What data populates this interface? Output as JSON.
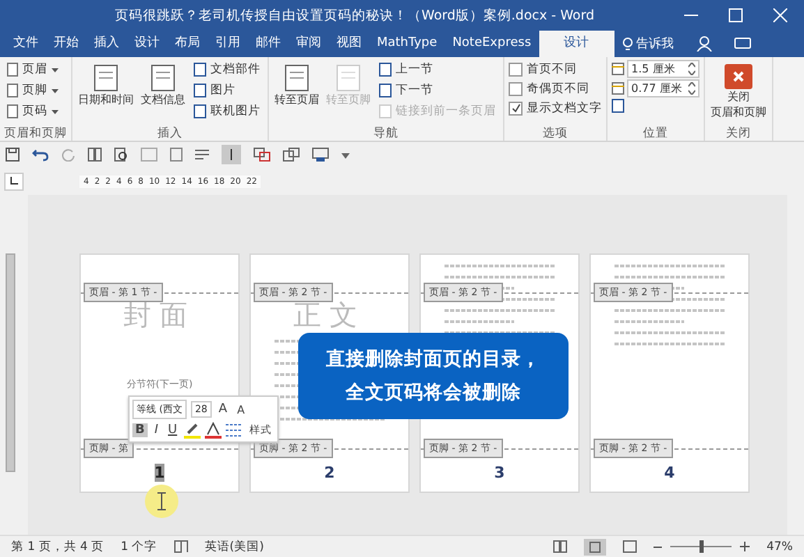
{
  "window": {
    "title": "页码很跳跃？老司机传授自由设置页码的秘诀！（Word版）案例.docx - Word"
  },
  "tabs": [
    {
      "label": "文件",
      "selected": false
    },
    {
      "label": "开始",
      "selected": false
    },
    {
      "label": "插入",
      "selected": false
    },
    {
      "label": "设计",
      "selected": false
    },
    {
      "label": "布局",
      "selected": false
    },
    {
      "label": "引用",
      "selected": false
    },
    {
      "label": "邮件",
      "selected": false
    },
    {
      "label": "审阅",
      "selected": false
    },
    {
      "label": "视图",
      "selected": false
    },
    {
      "label": "MathType",
      "selected": false
    },
    {
      "label": "NoteExpress",
      "selected": false
    },
    {
      "label": "设计",
      "selected": true
    }
  ],
  "tell_me": "告诉我",
  "ribbon": {
    "groups": [
      {
        "label": "页眉和页脚",
        "kind": "dropdowns",
        "items": [
          {
            "label": "页眉",
            "disabled": false
          },
          {
            "label": "页脚",
            "disabled": false
          },
          {
            "label": "页码",
            "disabled": false
          }
        ]
      },
      {
        "label": "插入",
        "kind": "mixed",
        "large": [
          {
            "label": "日期和时间",
            "disabled": false
          },
          {
            "label": "文档信息",
            "disabled": false
          }
        ],
        "items": [
          {
            "label": "文档部件",
            "disabled": false
          },
          {
            "label": "图片",
            "disabled": false
          },
          {
            "label": "联机图片",
            "disabled": false
          }
        ]
      },
      {
        "label": "导航",
        "kind": "mixed",
        "large": [
          {
            "label": "转至页眉",
            "disabled": false
          },
          {
            "label": "转至页脚",
            "disabled": true
          }
        ],
        "items": [
          {
            "label": "上一节",
            "disabled": false
          },
          {
            "label": "下一节",
            "disabled": false
          },
          {
            "label": "链接到前一条页眉",
            "disabled": true
          }
        ]
      },
      {
        "label": "选项",
        "kind": "checks",
        "items": [
          {
            "label": "首页不同",
            "checked": false
          },
          {
            "label": "奇偶页不同",
            "checked": false
          },
          {
            "label": "显示文档文字",
            "checked": true
          }
        ]
      },
      {
        "label": "位置",
        "kind": "spins",
        "items": [
          {
            "value": "1.5 厘米"
          },
          {
            "value": "0.77 厘米"
          }
        ]
      },
      {
        "label": "关闭",
        "kind": "close",
        "items": [
          {
            "lines": [
              "关闭",
              "页眉和页脚"
            ]
          }
        ]
      }
    ]
  },
  "ruler": {
    "ticks": [
      "4",
      "2",
      "2",
      "4",
      "6",
      "8",
      "10",
      "12",
      "14",
      "16",
      "18",
      "20",
      "22"
    ]
  },
  "pages": [
    {
      "kind": "cover",
      "title": "封面",
      "header_tag": "页眉 - 第 1 节 -",
      "footer_tag": "页脚 - 第",
      "section_break": "分节符(下一页)",
      "number": "1",
      "number_selected": true
    },
    {
      "kind": "body",
      "title": "正文",
      "header_tag": "页眉 - 第 2 节 -",
      "footer_tag": "页脚 - 第 2 节 -",
      "number": "2",
      "number_selected": false
    },
    {
      "kind": "body",
      "header_tag": "页眉 - 第 2 节 -",
      "footer_tag": "页脚 - 第 2 节 -",
      "number": "3",
      "number_selected": false
    },
    {
      "kind": "body",
      "header_tag": "页眉 - 第 2 节 -",
      "footer_tag": "页脚 - 第 2 节 -",
      "number": "4",
      "number_selected": false
    }
  ],
  "mini_toolbar": {
    "font": "等线 (西文",
    "size": "28",
    "grow": "A",
    "shrink": "A",
    "style_label": "样式",
    "buttons": [
      {
        "label": "B",
        "selected": true
      },
      {
        "label": "I",
        "selected": false
      },
      {
        "label": "U",
        "selected": false
      }
    ]
  },
  "callout": {
    "lines": [
      "直接删除封面页的目录，",
      "全文页码将会被删除"
    ]
  },
  "status_bar": {
    "page": "第 1 页，共 4 页",
    "words": "1 个字",
    "language": "英语(美国)",
    "zoom": "47%",
    "level": 0.5
  }
}
